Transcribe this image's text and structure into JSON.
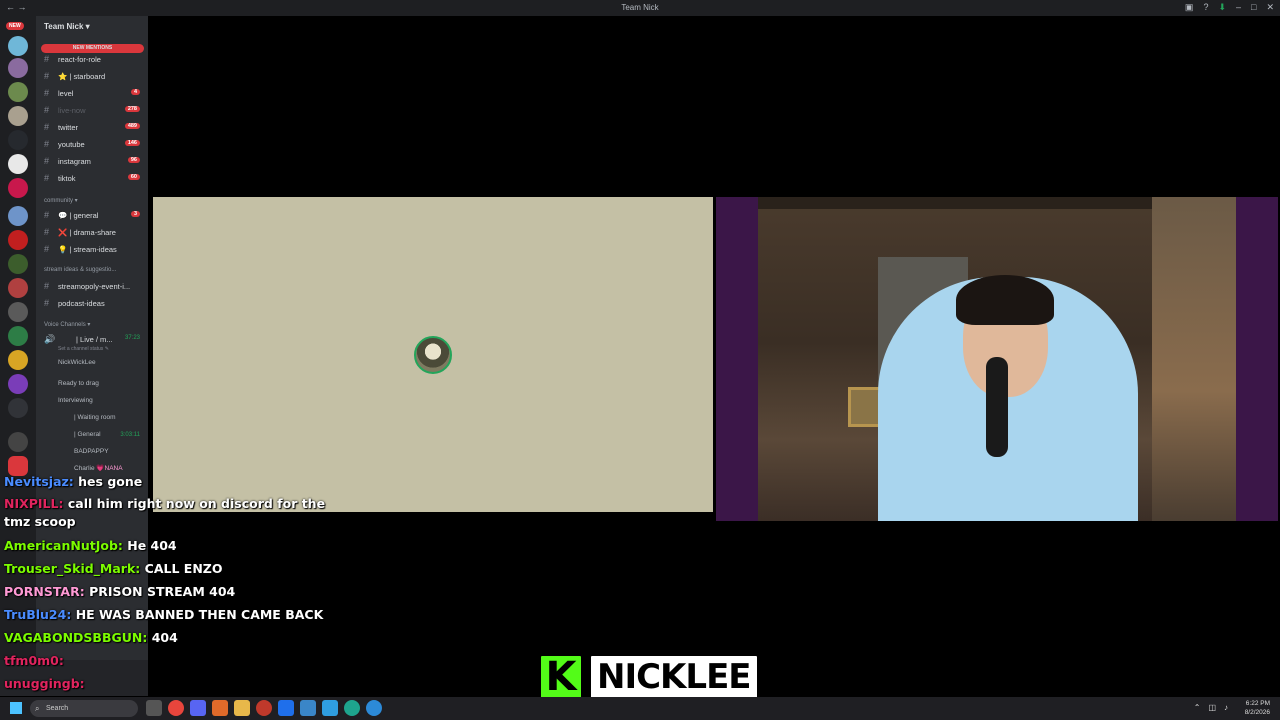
{
  "window": {
    "title": "Team Nick"
  },
  "server": {
    "name": "Team Nick ▾",
    "mentions_banner": "NEW MENTIONS",
    "new_tag": "NEW",
    "channels": [
      {
        "name": "react-for-role",
        "badge": ""
      },
      {
        "name": "⭐ | starboard",
        "badge": ""
      },
      {
        "name": "level",
        "badge": "4"
      },
      {
        "name": "live-now",
        "badge": "278"
      },
      {
        "name": "twitter",
        "badge": "489"
      },
      {
        "name": "youtube",
        "badge": "146"
      },
      {
        "name": "instagram",
        "badge": "96"
      },
      {
        "name": "tiktok",
        "badge": "60"
      }
    ],
    "category_community": "community ▾",
    "community_channels": [
      {
        "name": "💬 | general",
        "badge": "3"
      },
      {
        "name": "❌ | drama-share",
        "badge": ""
      },
      {
        "name": "💡 | stream-ideas",
        "badge": ""
      }
    ],
    "category_stream": "stream ideas & suggestio...",
    "stream_channels": [
      {
        "name": "streamopoly-event-i...",
        "badge": ""
      },
      {
        "name": "podcast-ideas",
        "badge": ""
      }
    ],
    "category_voice": "Voice Channels ▾",
    "voice": {
      "live_channel": "| Live / m...",
      "live_time": "37:23",
      "status": "Set a channel status ✎",
      "member": "NickWickLee",
      "ready": "Ready to drag",
      "interviewing": "Interviewing",
      "waiting": "| Waiting room",
      "general": "| General",
      "general_time": "3:03:11",
      "badpappy": "BADPAPPY",
      "charlie": "Charlie",
      "charlie_tag": "💗NANA"
    }
  },
  "chat": [
    {
      "user": "Nevitsjaz:",
      "text": "hes gone",
      "color": "#4a8cff"
    },
    {
      "user": "NIXPILL:",
      "text": "call him right now on discord for the tmz scoop",
      "color": "#e0245e"
    },
    {
      "user": "AmericanNutJob:",
      "text": "He 404",
      "color": "#7cfc00"
    },
    {
      "user": "Trouser_Skid_Mark:",
      "text": "CALL ENZO",
      "color": "#7cfc00"
    },
    {
      "user": "PORNSTAR:",
      "text": "PRISON STREAM 404",
      "color": "#ff9ad5"
    },
    {
      "user": "TruBlu24:",
      "text": "HE WAS BANNED THEN CAME BACK",
      "color": "#4a8cff"
    },
    {
      "user": "VAGABONDSBBGUN:",
      "text": "404",
      "color": "#7cfc00"
    },
    {
      "user": "tfm0m0:",
      "text": "",
      "color": "#e0245e"
    },
    {
      "user": "unuggingb:",
      "text": "",
      "color": "#e0245e"
    }
  ],
  "nameplate": {
    "logo": "K",
    "name": "NICKLEE",
    "accent": "#53fc18"
  },
  "taskbar": {
    "search_placeholder": "Search",
    "time": "6:22 PM",
    "date": "8/2/2026"
  }
}
